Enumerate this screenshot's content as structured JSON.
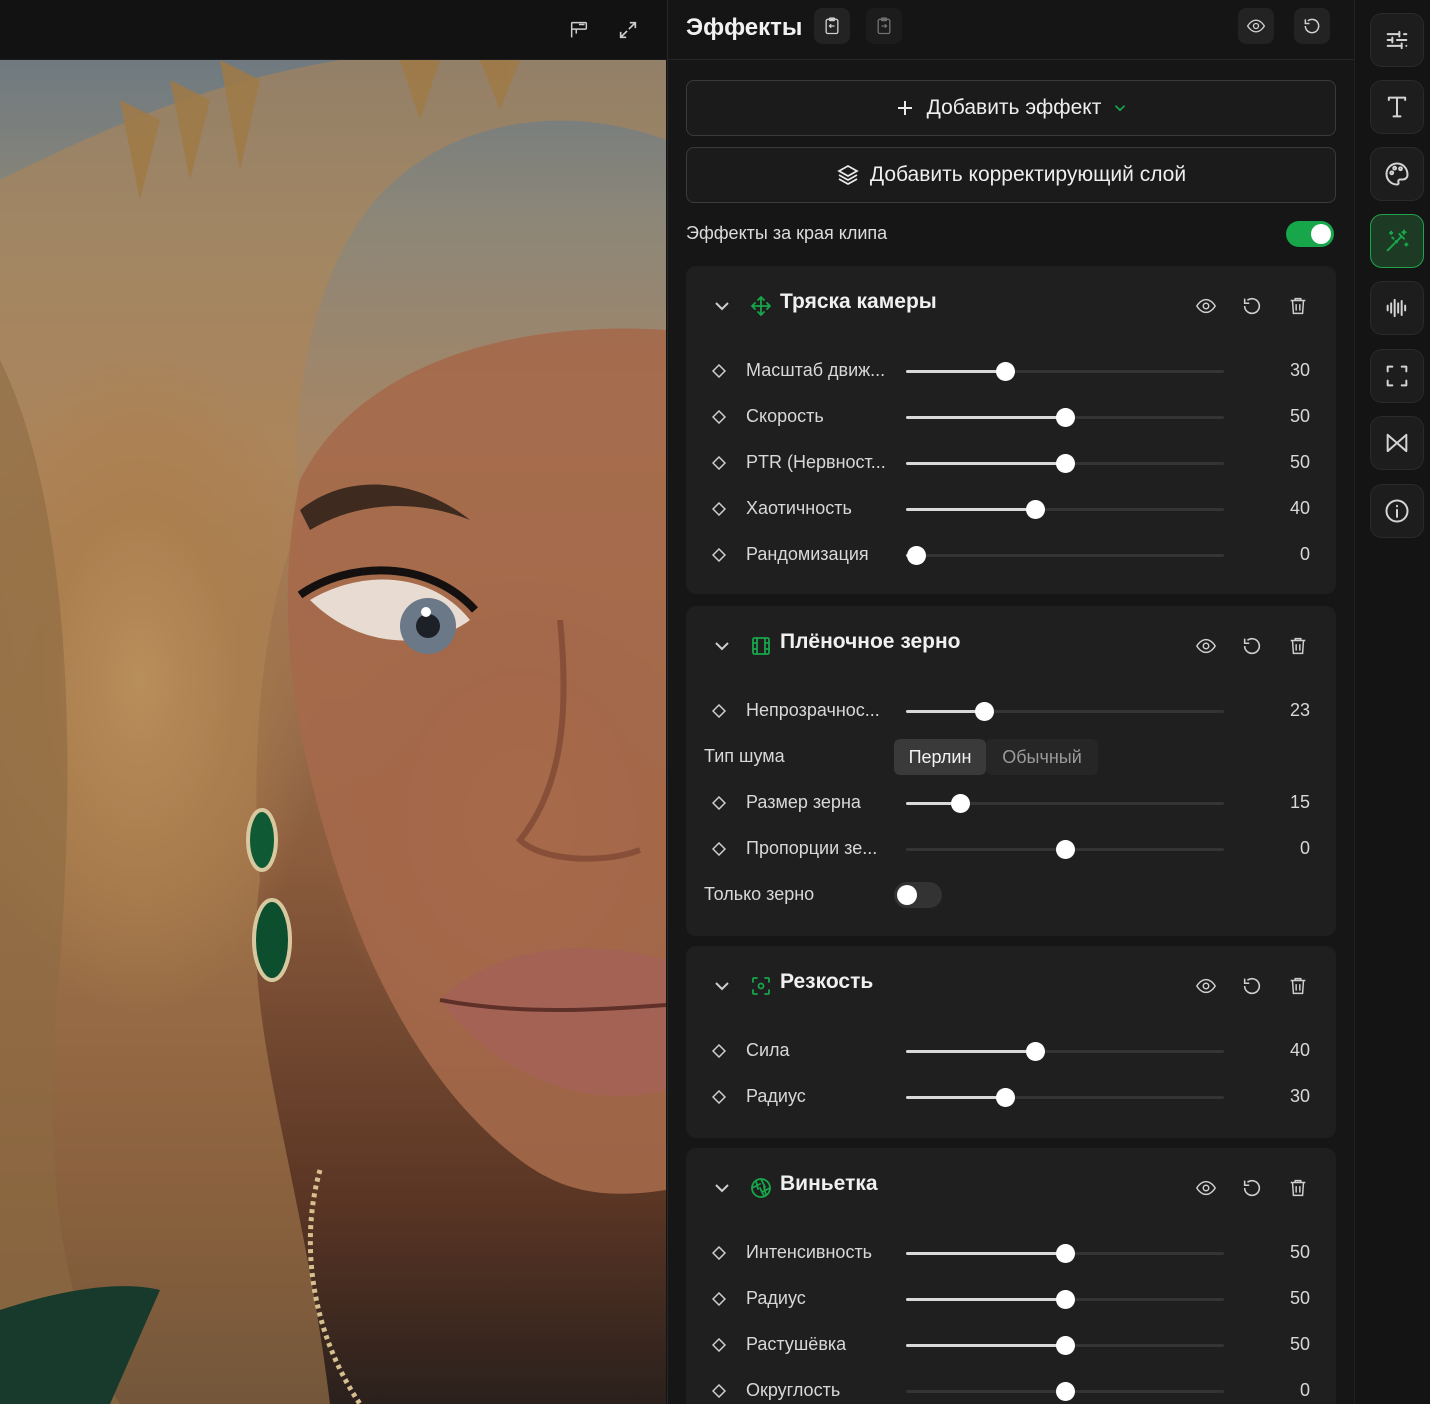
{
  "colors": {
    "accent": "#17a64a",
    "panel_bg": "#161616",
    "card_bg": "#1f1f1f"
  },
  "preview": {
    "toolbar_icons": [
      "compare-split-icon",
      "fullscreen-icon"
    ]
  },
  "panel": {
    "title": "Эффекты",
    "header_icons": [
      "paste-effects-icon",
      "copy-effects-icon",
      "eye-icon",
      "reset-icon"
    ],
    "add_effect_label": "Добавить эффект",
    "add_adjustment_label": "Добавить корректирующий слой",
    "beyond_clip_label": "Эффекты за края клипа",
    "beyond_clip_on": true
  },
  "effects": [
    {
      "title": "Тряска камеры",
      "icon": "move-arrows-icon",
      "params": [
        {
          "label": "Масштаб движ...",
          "value": "30",
          "fraction": 0.31
        },
        {
          "label": "Скорость",
          "value": "50",
          "fraction": 0.5
        },
        {
          "label": "PTR (Нервност...",
          "value": "50",
          "fraction": 0.5
        },
        {
          "label": "Хаотичность",
          "value": "40",
          "fraction": 0.405
        },
        {
          "label": "Рандомизация",
          "value": "0",
          "fraction": 0.03
        }
      ]
    },
    {
      "title": "Плёночное зерно",
      "icon": "film-icon",
      "params": [
        {
          "label": "Непрозрачнос...",
          "value": "23",
          "fraction": 0.245
        }
      ],
      "noise": {
        "label": "Тип шума",
        "options": [
          "Перлин",
          "Обычный"
        ],
        "selected": "Перлин"
      },
      "params2": [
        {
          "label": "Размер зерна",
          "value": "15",
          "fraction": 0.17
        },
        {
          "label": "Пропорции зе...",
          "value": "0",
          "fraction": 0.5,
          "centered": true
        }
      ],
      "grain_only": {
        "label": "Только зерно",
        "on": false
      }
    },
    {
      "title": "Резкость",
      "icon": "focus-icon",
      "params": [
        {
          "label": "Сила",
          "value": "40",
          "fraction": 0.405
        },
        {
          "label": "Радиус",
          "value": "30",
          "fraction": 0.31
        }
      ]
    },
    {
      "title": "Виньетка",
      "icon": "aperture-icon",
      "params": [
        {
          "label": "Интенсивность",
          "value": "50",
          "fraction": 0.5
        },
        {
          "label": "Радиус",
          "value": "50",
          "fraction": 0.5
        },
        {
          "label": "Растушёвка",
          "value": "50",
          "fraction": 0.5
        },
        {
          "label": "Округлость",
          "value": "0",
          "fraction": 0.5,
          "centered": true
        }
      ]
    }
  ],
  "rail": [
    "adjust-sliders-icon",
    "text-icon",
    "palette-icon",
    "magic-wand-icon",
    "audio-wave-icon",
    "crop-frame-icon",
    "transition-icon",
    "info-icon"
  ],
  "rail_active": "magic-wand-icon"
}
